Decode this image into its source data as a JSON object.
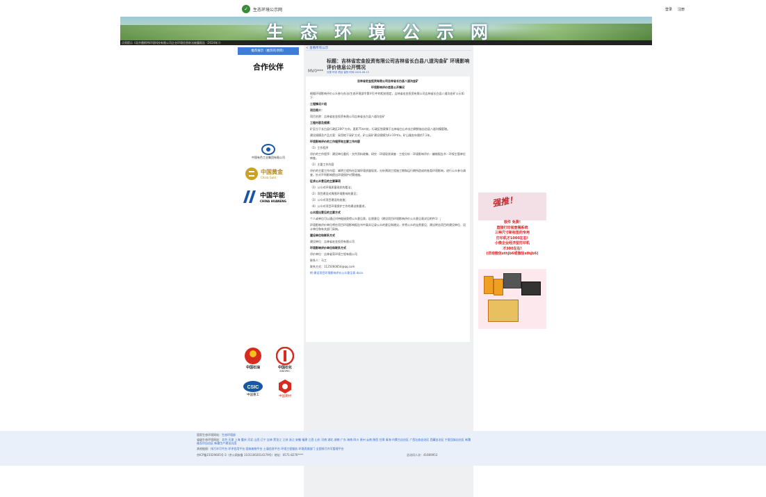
{
  "header": {
    "site_name": "生态环境公示网",
    "login": "登录",
    "register": "注册",
    "banner_title": "生态环境公示网",
    "ticker": "点亮提示《北京雷斯特环境科技有限公司企业环境信息依法披露报告（2024年）》"
  },
  "left": {
    "tab_label": "推荐展示（推荐的项目）",
    "partners_title": "合作伙伴",
    "logos": [
      {
        "icon": "china-nonferrous-logo",
        "name": "中国有色工业集团有限公司"
      },
      {
        "icon": "china-gold-logo",
        "name": "中国黄金",
        "sub": "China Gold"
      },
      {
        "icon": "huaneng-logo",
        "name": "中国华能",
        "sub": "CHINA HUANENG"
      },
      {
        "icon": "petrochina-logo",
        "name": "中国石油"
      },
      {
        "icon": "sinopec-logo",
        "name": "中国石化",
        "sub": "SINOPEC"
      },
      {
        "icon": "csic-logo",
        "name": "中国重工"
      },
      {
        "icon": "cnbm-logo",
        "name": "中国建材"
      }
    ]
  },
  "article": {
    "breadcrumb": "< 查看所有公示",
    "avatar_text": "MV0***",
    "title": "标题：吉林省宏金投资有限公司吉林省长白县八道沟金矿 环境影响评价信息公开情况",
    "meta": "分类  环评  项目  省份  时间 2024-08-15",
    "paragraphs": [
      {
        "style": "c",
        "text": "吉林省宏金投资有限公司吉林省长白县八道沟金矿"
      },
      {
        "style": "c",
        "text": "环境影响评价信息公开情况"
      },
      {
        "style": "",
        "text": "根据环境影响评价公众参与办法(生态环境部令第4号)中的相关规定，吉林省宏金投资有限公司吉林省长白县八道沟金矿公示如下："
      },
      {
        "style": "b",
        "text": "工程情况介绍"
      },
      {
        "style": "b",
        "text": "项目简介："
      },
      {
        "style": "",
        "text": "项目名称：吉林省宏金投资有限公司吉林省长白县八道沟金矿"
      },
      {
        "style": "b",
        "text": "工程内容及规模："
      },
      {
        "style": "",
        "text": "矿区位于长白县行政区280°方向，直距75km处，行政区划隶属于吉林省白山市长白朝鲜族自治县八道沟镇管辖。"
      },
      {
        "style": "",
        "text": "建设规模及产品方案：采用地下采矿方式，矿山采矿建设规模为6×10⁴t/a，矿山服务年限约7.1年。"
      },
      {
        "style": "b",
        "text": "环境影响评价的工作程序和主要工作内容"
      },
      {
        "style": "",
        "text": "（1）工作程序"
      },
      {
        "style": "",
        "text": "评价的工作程序：建设单位委托 - 文件资料收集、研究 - 环境现状调查 - 工程分析 - 环境影响评价 - 编制报告书 - 环保主管单位审查。"
      },
      {
        "style": "",
        "text": "（2）主要工作内容"
      },
      {
        "style": "",
        "text": "评价的主要工作内容：阐明工程所在区域环境质量现状，分析预测工程施工期和运行期所造成的各类环境影响，进行公众参与调查，针对不利影响提出环境保护对策措施。"
      },
      {
        "style": "b",
        "text": "征求公众意见的主要事项"
      },
      {
        "style": "",
        "text": "（1）公众对环境质量现状的看法；"
      },
      {
        "style": "",
        "text": "（2）项目建设对周围环境影响的意见；"
      },
      {
        "style": "",
        "text": "（3）公众对项目建设的态度；"
      },
      {
        "style": "",
        "text": "（4）公众对项目环境保护工作的建议和要求。"
      },
      {
        "style": "b",
        "text": "公众提出意见的主要方式"
      },
      {
        "style": "",
        "text": "个人或单位可以通过对待链接获得公众意见表，反馈意见（建设项目环境影响评价公众意见表详见附件1）；"
      },
      {
        "style": "",
        "text": "环境影响评价单位将在项目环境影响报告书中真实记录公众的意见和建议，并将公众的宝贵意见、建议转告项目的建设单位、设计单位和有关部门采纳。"
      },
      {
        "style": "b",
        "text": "建设单位和联系方式"
      },
      {
        "style": "",
        "text": "建设单位：吉林省宏金投资有限公司"
      },
      {
        "style": "b",
        "text": "环境影响评价单位和联系方式"
      },
      {
        "style": "",
        "text": "评价单位：吉林省亮环境工程有限公司"
      },
      {
        "style": "",
        "text": "联系人：马工"
      },
      {
        "style": "",
        "text": "联系方式：1125060854@qq.com"
      },
      {
        "style": "link",
        "text": "附:建设项目环境影响评价公众意见表.docx"
      }
    ]
  },
  "ad": {
    "burst": "强推！",
    "lines": [
      "软件 免费!",
      "直接打印省查摆系统",
      "三种尺寸新标签的专用",
      "打印机才1000左右!",
      "小微企业经济型打印机",
      "才300左右!",
      "(详询微信sthjb6或微信sthjb6)"
    ]
  },
  "footer": {
    "row1_label": "国家生态环境网站：",
    "row1_links": "生态环境部",
    "row2_label": "省级生态环境网站：",
    "row2_links": "北京 天津 上海 重庆 河北 山西 辽宁 吉林 黑龙江 江苏 浙江 安徽 福建 江西 山东 河南 湖北 湖南 广东 海南 四川 贵州 云南 陕西 甘肃 青海 内蒙古自治区 广西壮族自治区 西藏自治区 宁夏回族自治区 新疆维吾尔自治区 新疆生产建设兵团",
    "row3_label": "其他链接：",
    "row3_links": "排污许可平台  环评信用平台  固体废物平台  土壤信息平台  环境工程服务  环境资源部门  全国排污许可管理平台",
    "icp": "京ICP备15029605号-3（京公网安备 11011002014179号）地址：0571-8276****",
    "stats": "总访问人次：41669953"
  }
}
